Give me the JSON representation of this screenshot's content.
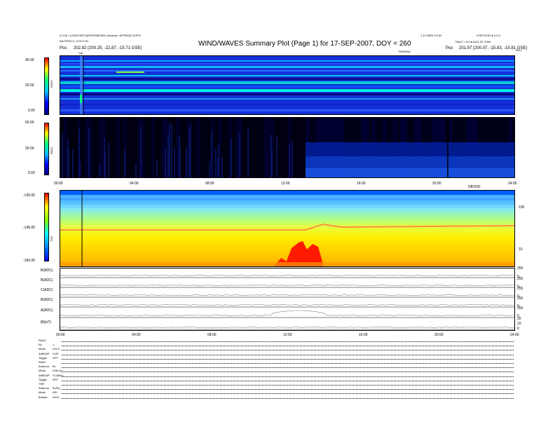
{
  "header": {
    "left_line1": "0.0.00 • 0.0000 BPC/ARP/RGB/GRD (%value) • A/FREQ/TJ/OPS",
    "left_line2": "AS/JFR/0.3 • 0.00 0.00",
    "left_pos_label": "Pos",
    "left_pos_value": "202.82 (200.25, -22.87, -15.71 GSE)",
    "title": "WIND/WAVES Summary Plot (Page 1) for 17-SEP-2007, DOY = 260",
    "right_line1": "1.10 WED 0.0.00",
    "right_line2": "LISRTOOR ● 0.0.0",
    "right_line3": "DAILY • 0.0 ● AUG 20, 2000",
    "right_pos_label": "Pos",
    "right_pos_value": "201.97 (200.07, -15.83, -15.81 GSE)",
    "cal_label": "Cal",
    "top_right_unit": "0HU",
    "tnr_top_label": "TNR/RAD"
  },
  "rad2": {
    "ylabel": "RAD2",
    "ticks": [
      "40.00",
      "20.00",
      "0.00"
    ]
  },
  "rad1": {
    "ylabel": "RAD1",
    "ticks": [
      "60.00",
      "30.00",
      "0.00"
    ],
    "xticks": [
      "00:00",
      "04:00",
      "08:00",
      "12:00",
      "16:00",
      "20:00",
      "24:00"
    ],
    "xlabel_right": "DBYDD"
  },
  "tnr": {
    "ylabel": "TNR",
    "ticks": [
      "-130.00",
      "-145.00",
      "-160.00"
    ],
    "right_ticks": [
      "100",
      "10"
    ]
  },
  "lines": {
    "labels": [
      "B(ADC)",
      "B(ADC)",
      "C(ADC)",
      "B(ADC)",
      "A(ADC)",
      "|B|(nT)"
    ],
    "right_ticks": [
      "255",
      "0",
      "255",
      "0",
      "255",
      "0",
      "255",
      "0",
      "255",
      "0",
      "20",
      "10",
      "0"
    ],
    "xticks": [
      "00:00",
      "04:00",
      "08:00",
      "12:00",
      "16:00",
      "20:00",
      "24:00"
    ]
  },
  "footer": {
    "rows": [
      {
        "k": "RAD2",
        "v": ""
      },
      {
        "k": "Rx",
        "v": "1"
      },
      {
        "k": "Mode",
        "v": "LIN S"
      },
      {
        "k": "3dBGAP",
        "v": "S.6P"
      },
      {
        "k": "Toggle",
        "v": "OFF"
      },
      {
        "k": "RAD1",
        "v": ""
      },
      {
        "k": "Antenna",
        "v": "Ex"
      },
      {
        "k": "Mode",
        "v": "LIN/LAJ"
      },
      {
        "k": "3dBGAP",
        "v": "S.GMHz"
      },
      {
        "k": "Toggle",
        "v": "OFF"
      },
      {
        "k": "TNR",
        "v": ""
      },
      {
        "k": "Antenna",
        "v": "Ex/Ey"
      },
      {
        "k": "Mode",
        "v": "A/D"
      },
      {
        "k": "Bumps",
        "v": "A/D/L"
      }
    ]
  },
  "chart_data": [
    {
      "type": "heatmap",
      "title": "RAD2",
      "xlabel": "",
      "ylabel": "RAD2",
      "ylim": [
        0,
        45
      ],
      "x_range": [
        "00:00",
        "24:00"
      ],
      "colorscale": [
        "#000080",
        "#0000ff",
        "#00bfff",
        "#00ff80",
        "#ffff00",
        "#ff0000"
      ],
      "features": [
        "persistent narrowband lines",
        "calibration spike near 01:20"
      ]
    },
    {
      "type": "heatmap",
      "title": "RAD1",
      "xlabel": "",
      "ylabel": "RAD1",
      "ylim": [
        0,
        60
      ],
      "x_range": [
        "00:00",
        "24:00"
      ],
      "colorscale": [
        "#000080",
        "#0000ff",
        "#00bfff",
        "#00ff80",
        "#ffff00",
        "#ff0000"
      ],
      "features": [
        "enhanced blue emission after 12:30"
      ]
    },
    {
      "type": "heatmap",
      "title": "TNR",
      "xlabel": "",
      "ylabel": "TNR",
      "ylim": [
        -160,
        -125
      ],
      "x_range": [
        "00:00",
        "24:00"
      ],
      "colorscale": [
        "#ff0000",
        "#ffff00",
        "#80ff00",
        "#00ffff",
        "#0080ff",
        "#0000ff"
      ],
      "features": [
        "red burst around 13:00-14:00",
        "plasma line near 10 kHz"
      ]
    }
  ]
}
